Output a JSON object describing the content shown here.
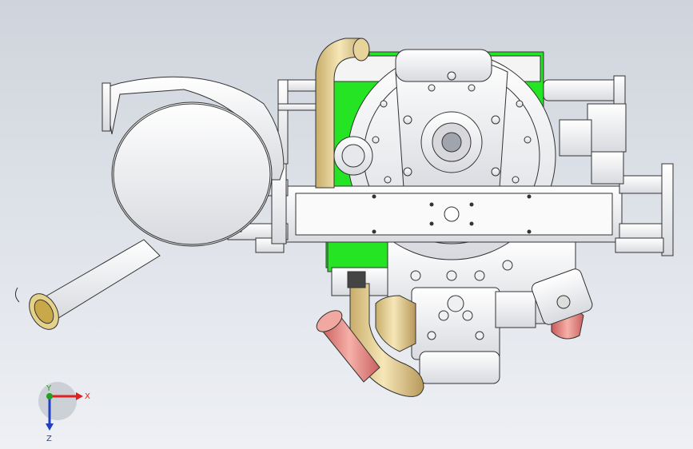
{
  "viewport": {
    "background_top": "#cfd4dc",
    "background_bottom": "#eef0f4"
  },
  "triad": {
    "x_label": "X",
    "y_label": "Y",
    "z_label": "Z",
    "x_color": "#e02020",
    "y_color": "#20a020",
    "z_color": "#2040c0"
  },
  "model": {
    "body_color": "#f2f2f4",
    "line_color": "#3a3a3a",
    "accent_green": "#22e022",
    "hose_color": "#e8d49a",
    "pipe_color": "#e88080"
  }
}
